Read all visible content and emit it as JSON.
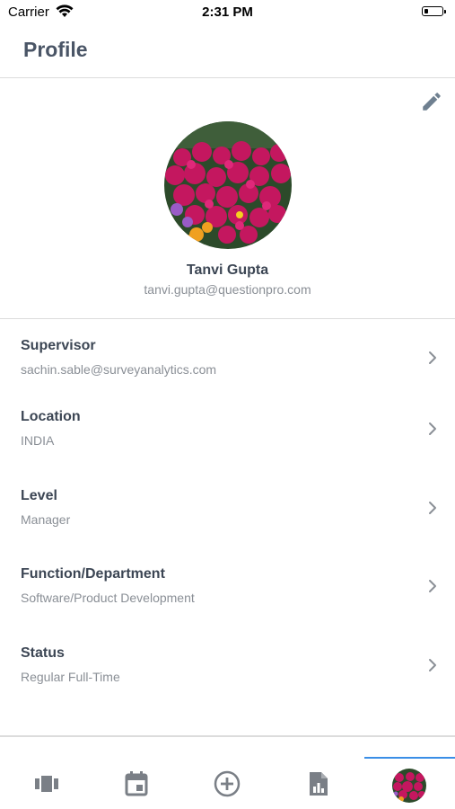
{
  "status_bar": {
    "carrier": "Carrier",
    "time": "2:31 PM"
  },
  "header": {
    "title": "Profile"
  },
  "profile": {
    "name": "Tanvi Gupta",
    "email": "tanvi.gupta@questionpro.com",
    "edit_icon": "pencil-icon"
  },
  "details": [
    {
      "label": "Supervisor",
      "value": "sachin.sable@surveyanalytics.com"
    },
    {
      "label": "Location",
      "value": "INDIA"
    },
    {
      "label": "Level",
      "value": "Manager"
    },
    {
      "label": "Function/Department",
      "value": "Software/Product Development"
    },
    {
      "label": "Status",
      "value": "Regular Full-Time"
    }
  ],
  "tab_bar": {
    "tabs": [
      {
        "icon": "cards-icon"
      },
      {
        "icon": "calendar-icon"
      },
      {
        "icon": "add-circle-icon"
      },
      {
        "icon": "report-icon"
      },
      {
        "icon": "profile-avatar",
        "active": true
      }
    ],
    "active_color": "#3a8ee6",
    "icon_color": "#7a7f86"
  },
  "colors": {
    "title": "#4a5566",
    "secondary_text": "#8a8f96",
    "accent": "#3a8ee6",
    "avatar_primary": "#c4175f"
  }
}
